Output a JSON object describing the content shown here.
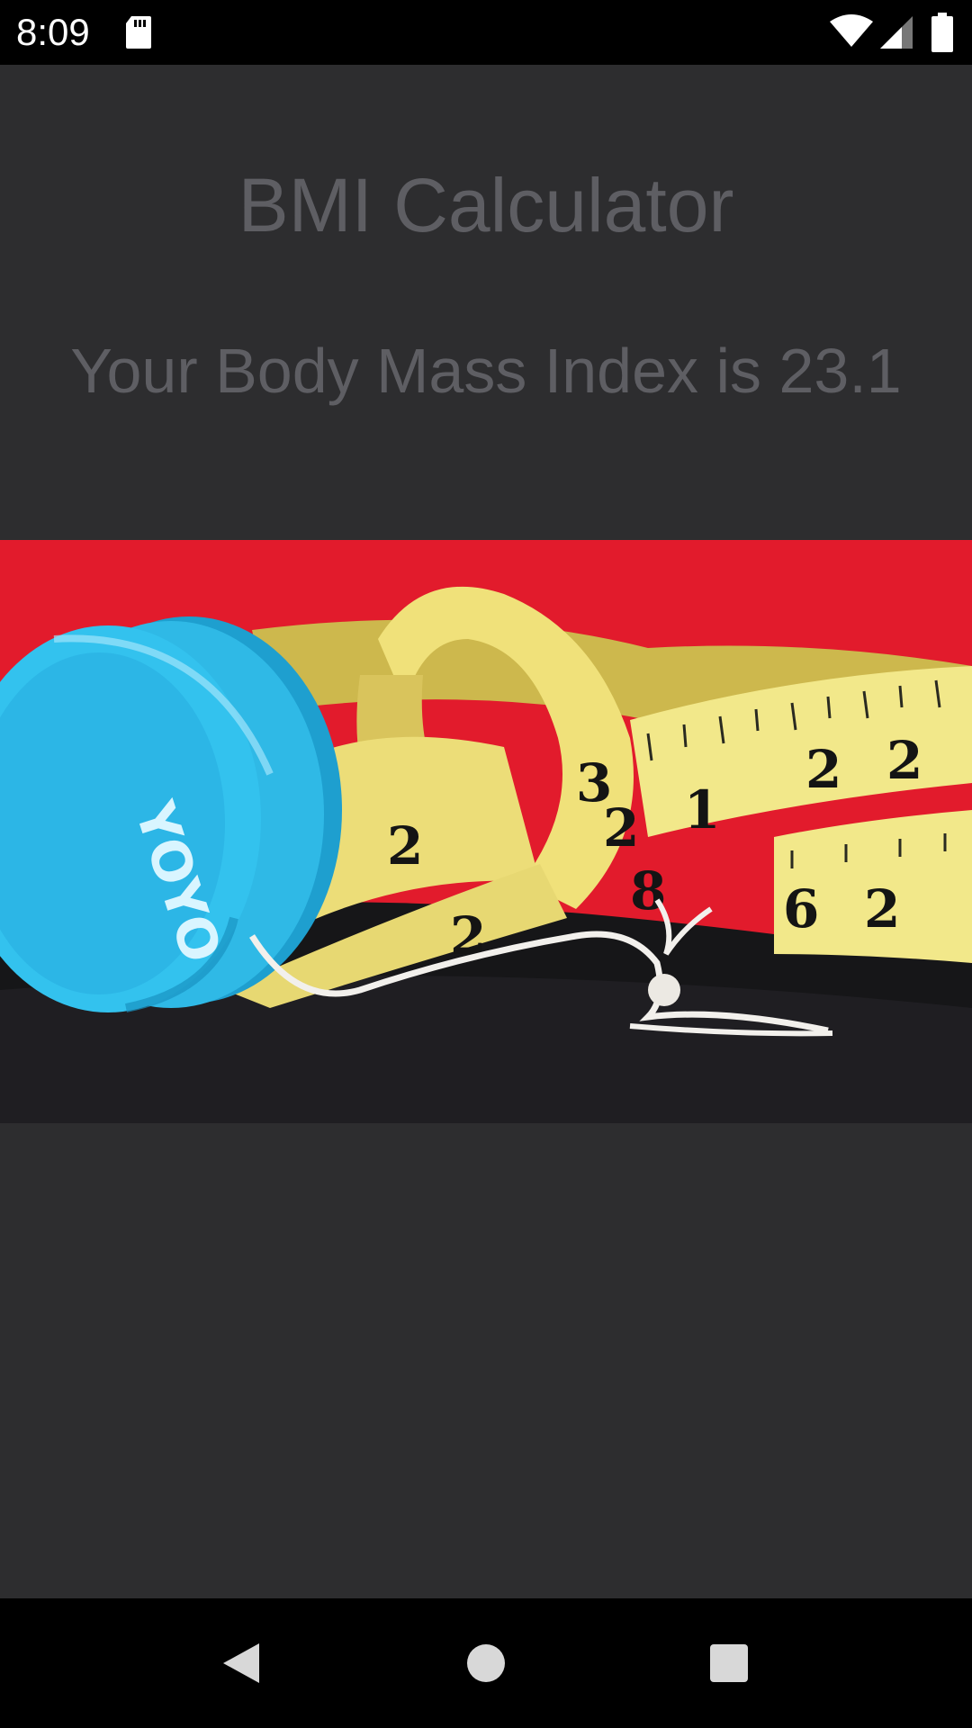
{
  "status_bar": {
    "time": "8:09",
    "icons": [
      "sd-card-icon",
      "wifi-icon",
      "cell-signal-icon",
      "battery-icon"
    ]
  },
  "app": {
    "title": "BMI Calculator",
    "result_text": "Your Body Mass Index is 23.1"
  },
  "hero_image": {
    "description_icon": "yoyo-and-measuring-tape-image",
    "yoyo_text": "YOYO",
    "tape_numbers": [
      "3",
      "2",
      "1",
      "2",
      "2",
      "2",
      "6",
      "2",
      "8",
      "2"
    ]
  },
  "nav_bar": {
    "buttons": [
      "back",
      "home",
      "recents"
    ]
  },
  "colors": {
    "background": "#2d2d2f",
    "text": "#5e5e63",
    "bars": "#000000",
    "image_red": "#e21b2c",
    "yoyo_blue": "#2fb9e6",
    "tape_yellow": "#f2e88a"
  }
}
